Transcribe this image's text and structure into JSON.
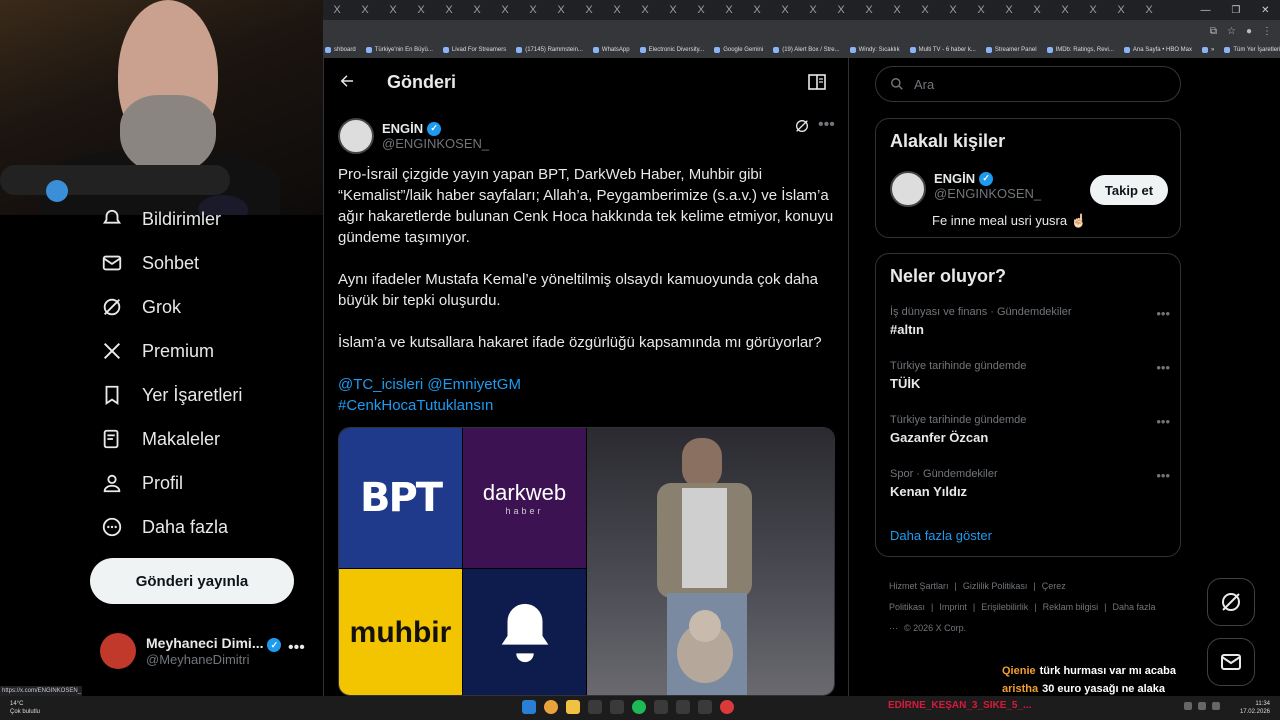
{
  "browser": {
    "tab_glyph": "X",
    "bookmarks": [
      "shboard",
      "Türkiye'nin En Büyü...",
      "Livad For Streamers",
      "(17145) Rammstein...",
      "WhatsApp",
      "Electronic Diversity...",
      "Google Gemini",
      "(19) Alert Box / Stre...",
      "Windy: Sıcaklık",
      "Multi TV - 6 haber k...",
      "Streamer Panel",
      "IMDb: Ratings, Revi...",
      "Ana Sayfa • HBO Max",
      "»",
      "Tüm Yer İşaretleri"
    ]
  },
  "nav": {
    "items": [
      {
        "label": "Bildirimler",
        "icon": "bell-icon"
      },
      {
        "label": "Sohbet",
        "icon": "mail-icon"
      },
      {
        "label": "Grok",
        "icon": "grok-icon"
      },
      {
        "label": "Premium",
        "icon": "x-logo-icon"
      },
      {
        "label": "Yer İşaretleri",
        "icon": "bookmark-icon"
      },
      {
        "label": "Makaleler",
        "icon": "article-icon"
      },
      {
        "label": "Profil",
        "icon": "person-icon"
      },
      {
        "label": "Daha fazla",
        "icon": "more-circle-icon"
      }
    ],
    "post_button": "Gönderi yayınla",
    "account": {
      "name": "Meyhaneci Dimi...",
      "handle": "@MeyhaneDimitri",
      "more": "•••"
    }
  },
  "main": {
    "title": "Gönderi",
    "author": {
      "name": "ENGİN",
      "handle": "@ENGINKOSEN_"
    },
    "more": "•••",
    "paragraphs": [
      "Pro-İsrail çizgide yayın yapan BPT, DarkWeb Haber, Muhbir gibi “Kemalist”/laik haber sayfaları; Allah’a, Peygamberimize (s.a.v.) ve İslam’a ağır hakaretlerde bulunan Cenk Hoca hakkında tek kelime etmiyor, konuyu gündeme taşımıyor.",
      "Aynı ifadeler Mustafa Kemal’e yöneltilmiş olsaydı kamuoyunda çok daha büyük bir tepki oluşurdu.",
      "İslam’a ve kutsallara hakaret ifade özgürlüğü kapsamında mı görüyorlar?"
    ],
    "links": [
      "@TC_icisleri @EmniyetGM",
      "#CenkHocaTutuklansın"
    ],
    "media": {
      "bpt": "BPT",
      "darkweb": "darkweb",
      "darkweb_sub": "haber",
      "muhbir": "muhbir"
    }
  },
  "right": {
    "search_placeholder": "Ara",
    "related": {
      "title": "Alakalı kişiler",
      "name": "ENGİN",
      "handle": "@ENGINKOSEN_",
      "bio": "Fe inne meal usri yusra ☝🏻",
      "follow": "Takip et"
    },
    "trends": {
      "title": "Neler oluyor?",
      "items": [
        {
          "context": "İş dünyası ve finans · Gündemdekiler",
          "topic": "#altın"
        },
        {
          "context": "Türkiye tarihinde gündemde",
          "topic": "TÜİK"
        },
        {
          "context": "Türkiye tarihinde gündemde",
          "topic": "Gazanfer Özcan"
        },
        {
          "context": "Spor · Gündemdekiler",
          "topic": "Kenan Yıldız"
        }
      ],
      "more_glyph": "•••",
      "show_more": "Daha fazla göster"
    },
    "footer": [
      "Hizmet Şartları",
      "|",
      "Gizlilik Politikası",
      "|",
      "Çerez Politikası",
      "|",
      "Imprint",
      "|",
      "Erişilebilirlik",
      "|",
      "Reklam bilgisi",
      "|",
      "Daha fazla ···",
      "© 2026 X Corp."
    ]
  },
  "chat": [
    {
      "user": "Qienie",
      "message": "türk hurması var mı acaba"
    },
    {
      "user": "aristha",
      "message": "30 euro yasağı ne alaka"
    }
  ],
  "status_url": "https://x.com/ENGINKOSEN_",
  "taskbar": {
    "weather_temp": "14°C",
    "weather_desc": "Çok bulutlu",
    "ticker": "EDİRNE_KEŞAN_3_SIKE_5_...",
    "time": "11:34",
    "date": "17.02.2026"
  }
}
